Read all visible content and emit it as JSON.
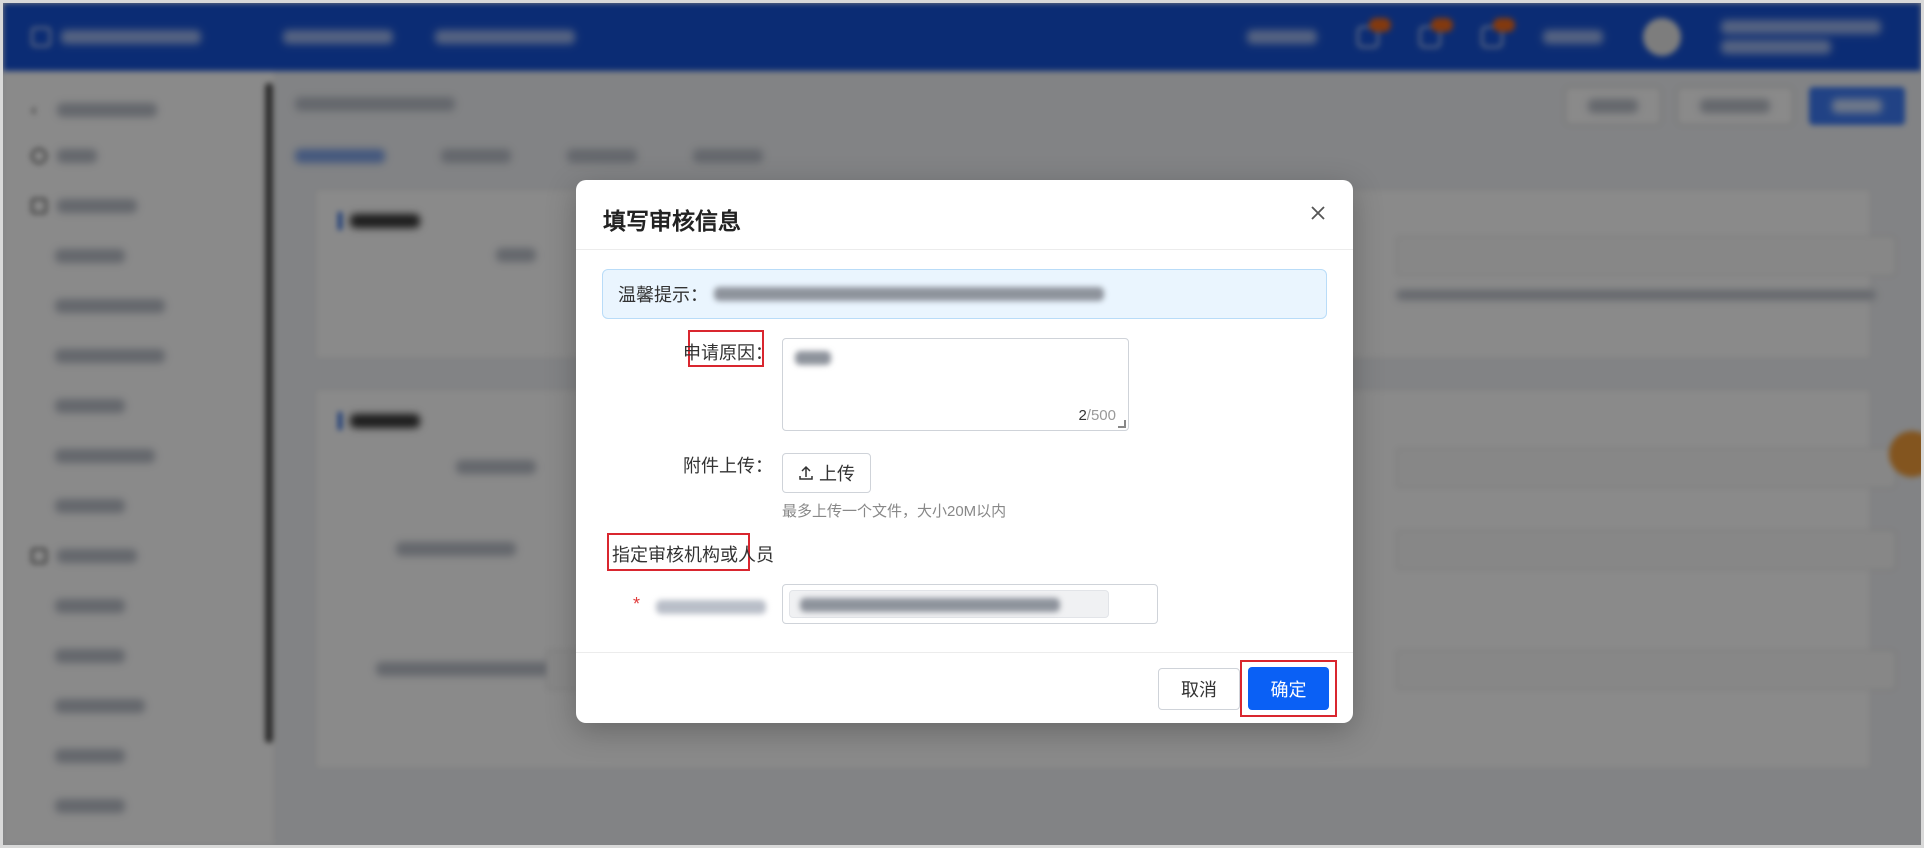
{
  "modal": {
    "title": "填写审核信息",
    "tip_label": "温馨提示：",
    "reason_label": "申请原因：",
    "reason_count_current": "2",
    "reason_count_max": "/500",
    "attachment_label": "附件上传：",
    "upload_button": "上传",
    "upload_hint": "最多上传一个文件，大小20M以内",
    "designate_label": "指定审核机构或人员",
    "required_mark": "*",
    "cancel_button": "取消",
    "ok_button": "确定"
  },
  "colors": {
    "topbar": "#1652d6",
    "primary_button": "#0a60f5",
    "annotation_red": "#d9262f",
    "tip_background": "#eaf5fe"
  },
  "icons": {
    "close": "close-icon",
    "upload": "upload-icon"
  }
}
